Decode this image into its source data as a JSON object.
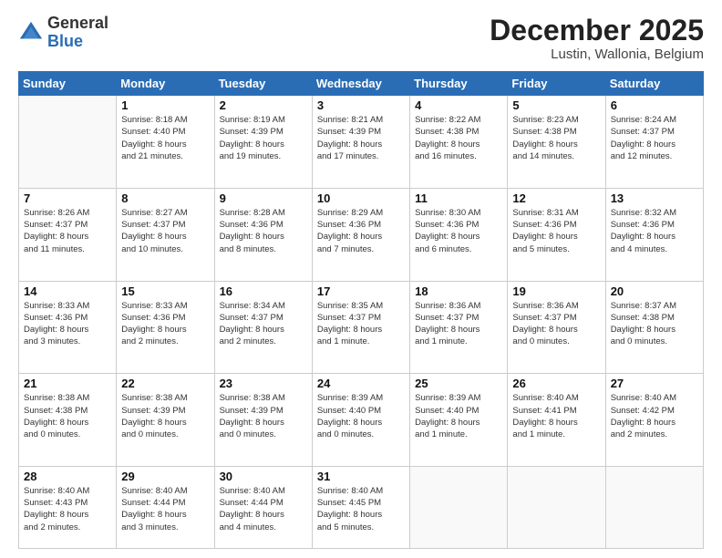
{
  "header": {
    "logo_general": "General",
    "logo_blue": "Blue",
    "month_title": "December 2025",
    "location": "Lustin, Wallonia, Belgium"
  },
  "weekdays": [
    "Sunday",
    "Monday",
    "Tuesday",
    "Wednesday",
    "Thursday",
    "Friday",
    "Saturday"
  ],
  "days": [
    {
      "num": "",
      "info": ""
    },
    {
      "num": "1",
      "info": "Sunrise: 8:18 AM\nSunset: 4:40 PM\nDaylight: 8 hours\nand 21 minutes."
    },
    {
      "num": "2",
      "info": "Sunrise: 8:19 AM\nSunset: 4:39 PM\nDaylight: 8 hours\nand 19 minutes."
    },
    {
      "num": "3",
      "info": "Sunrise: 8:21 AM\nSunset: 4:39 PM\nDaylight: 8 hours\nand 17 minutes."
    },
    {
      "num": "4",
      "info": "Sunrise: 8:22 AM\nSunset: 4:38 PM\nDaylight: 8 hours\nand 16 minutes."
    },
    {
      "num": "5",
      "info": "Sunrise: 8:23 AM\nSunset: 4:38 PM\nDaylight: 8 hours\nand 14 minutes."
    },
    {
      "num": "6",
      "info": "Sunrise: 8:24 AM\nSunset: 4:37 PM\nDaylight: 8 hours\nand 12 minutes."
    },
    {
      "num": "7",
      "info": "Sunrise: 8:26 AM\nSunset: 4:37 PM\nDaylight: 8 hours\nand 11 minutes."
    },
    {
      "num": "8",
      "info": "Sunrise: 8:27 AM\nSunset: 4:37 PM\nDaylight: 8 hours\nand 10 minutes."
    },
    {
      "num": "9",
      "info": "Sunrise: 8:28 AM\nSunset: 4:36 PM\nDaylight: 8 hours\nand 8 minutes."
    },
    {
      "num": "10",
      "info": "Sunrise: 8:29 AM\nSunset: 4:36 PM\nDaylight: 8 hours\nand 7 minutes."
    },
    {
      "num": "11",
      "info": "Sunrise: 8:30 AM\nSunset: 4:36 PM\nDaylight: 8 hours\nand 6 minutes."
    },
    {
      "num": "12",
      "info": "Sunrise: 8:31 AM\nSunset: 4:36 PM\nDaylight: 8 hours\nand 5 minutes."
    },
    {
      "num": "13",
      "info": "Sunrise: 8:32 AM\nSunset: 4:36 PM\nDaylight: 8 hours\nand 4 minutes."
    },
    {
      "num": "14",
      "info": "Sunrise: 8:33 AM\nSunset: 4:36 PM\nDaylight: 8 hours\nand 3 minutes."
    },
    {
      "num": "15",
      "info": "Sunrise: 8:33 AM\nSunset: 4:36 PM\nDaylight: 8 hours\nand 2 minutes."
    },
    {
      "num": "16",
      "info": "Sunrise: 8:34 AM\nSunset: 4:37 PM\nDaylight: 8 hours\nand 2 minutes."
    },
    {
      "num": "17",
      "info": "Sunrise: 8:35 AM\nSunset: 4:37 PM\nDaylight: 8 hours\nand 1 minute."
    },
    {
      "num": "18",
      "info": "Sunrise: 8:36 AM\nSunset: 4:37 PM\nDaylight: 8 hours\nand 1 minute."
    },
    {
      "num": "19",
      "info": "Sunrise: 8:36 AM\nSunset: 4:37 PM\nDaylight: 8 hours\nand 0 minutes."
    },
    {
      "num": "20",
      "info": "Sunrise: 8:37 AM\nSunset: 4:38 PM\nDaylight: 8 hours\nand 0 minutes."
    },
    {
      "num": "21",
      "info": "Sunrise: 8:38 AM\nSunset: 4:38 PM\nDaylight: 8 hours\nand 0 minutes."
    },
    {
      "num": "22",
      "info": "Sunrise: 8:38 AM\nSunset: 4:39 PM\nDaylight: 8 hours\nand 0 minutes."
    },
    {
      "num": "23",
      "info": "Sunrise: 8:38 AM\nSunset: 4:39 PM\nDaylight: 8 hours\nand 0 minutes."
    },
    {
      "num": "24",
      "info": "Sunrise: 8:39 AM\nSunset: 4:40 PM\nDaylight: 8 hours\nand 0 minutes."
    },
    {
      "num": "25",
      "info": "Sunrise: 8:39 AM\nSunset: 4:40 PM\nDaylight: 8 hours\nand 1 minute."
    },
    {
      "num": "26",
      "info": "Sunrise: 8:40 AM\nSunset: 4:41 PM\nDaylight: 8 hours\nand 1 minute."
    },
    {
      "num": "27",
      "info": "Sunrise: 8:40 AM\nSunset: 4:42 PM\nDaylight: 8 hours\nand 2 minutes."
    },
    {
      "num": "28",
      "info": "Sunrise: 8:40 AM\nSunset: 4:43 PM\nDaylight: 8 hours\nand 2 minutes."
    },
    {
      "num": "29",
      "info": "Sunrise: 8:40 AM\nSunset: 4:44 PM\nDaylight: 8 hours\nand 3 minutes."
    },
    {
      "num": "30",
      "info": "Sunrise: 8:40 AM\nSunset: 4:44 PM\nDaylight: 8 hours\nand 4 minutes."
    },
    {
      "num": "31",
      "info": "Sunrise: 8:40 AM\nSunset: 4:45 PM\nDaylight: 8 hours\nand 5 minutes."
    }
  ]
}
